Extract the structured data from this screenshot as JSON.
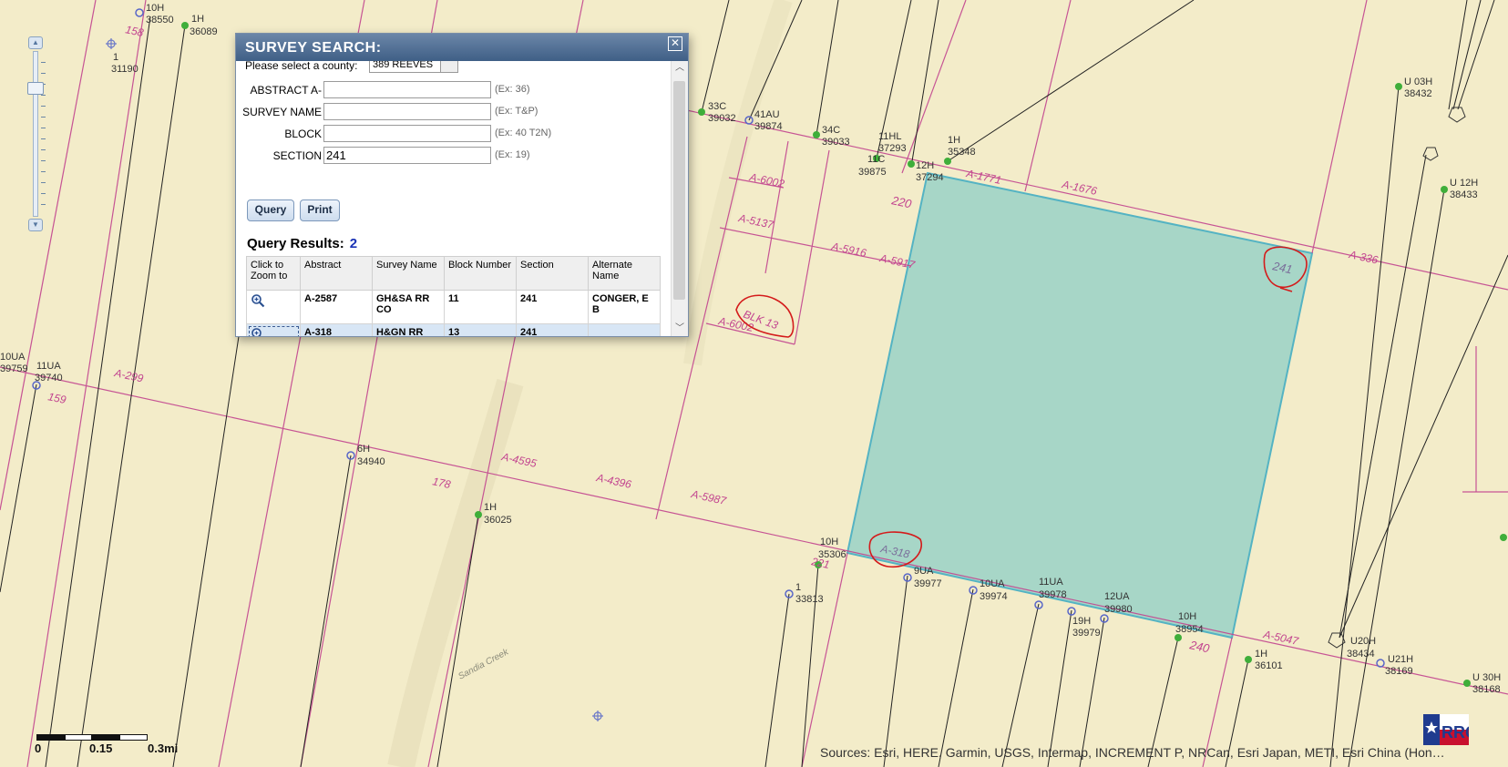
{
  "dialog": {
    "title": "SURVEY SEARCH:",
    "close_glyph": "✕",
    "county_label": "Please select a county:",
    "county_value": "389 REEVES",
    "fields": [
      {
        "label": "ABSTRACT A-",
        "value": "",
        "hint": "(Ex: 36)"
      },
      {
        "label": "SURVEY NAME",
        "value": "",
        "hint": "(Ex: T&P)"
      },
      {
        "label": "BLOCK",
        "value": "",
        "hint": "(Ex: 40 T2N)"
      },
      {
        "label": "SECTION",
        "value": "241",
        "hint": "(Ex: 19)"
      }
    ],
    "query_button": "Query",
    "print_button": "Print",
    "results_label": "Query Results:",
    "results_count": "2",
    "columns": [
      "Click to Zoom to",
      "Abstract",
      "Survey Name",
      "Block Number",
      "Section",
      "Alternate Name"
    ],
    "rows": [
      {
        "abstract": "A-2587",
        "survey": "GH&SA RR CO",
        "block": "11",
        "section": "241",
        "alt": "CONGER, E B"
      },
      {
        "abstract": "A-318",
        "survey": "H&GN RR CO",
        "block": "13",
        "section": "241",
        "alt": ""
      }
    ]
  },
  "map": {
    "wells": [
      {
        "name": "10H",
        "id": "38550"
      },
      {
        "name": "1H",
        "id": "36089"
      },
      {
        "name": "1",
        "id": "31190"
      },
      {
        "name": "33C",
        "id": "39032"
      },
      {
        "name": "41AU",
        "id": "39874"
      },
      {
        "name": "34C",
        "id": "39033"
      },
      {
        "name": "11HL",
        "id": "37293"
      },
      {
        "name": "1H",
        "id": "35348"
      },
      {
        "name": "11C",
        "id": "39875"
      },
      {
        "name": "12H",
        "id": "37294"
      },
      {
        "name": "U 03H",
        "id": "38432"
      },
      {
        "name": "U 12H",
        "id": "38433"
      },
      {
        "name": "10UA",
        "id": "39759"
      },
      {
        "name": "11UA",
        "id": "39740"
      },
      {
        "name": "6H",
        "id": "34940"
      },
      {
        "name": "1H",
        "id": "36025"
      },
      {
        "name": "10H",
        "id": "35306"
      },
      {
        "name": "1",
        "id": "33813"
      },
      {
        "name": "9UA",
        "id": "39977"
      },
      {
        "name": "10UA",
        "id": "39974"
      },
      {
        "name": "11UA",
        "id": "39978"
      },
      {
        "name": "12UA",
        "id": "39980"
      },
      {
        "name": "19H",
        "id": "39979"
      },
      {
        "name": "10H",
        "id": "38954"
      },
      {
        "name": "1H",
        "id": "36101"
      },
      {
        "name": "U20H",
        "id": "38434"
      },
      {
        "name": "U21H",
        "id": "38169"
      },
      {
        "name": "U 30H",
        "id": "38168"
      }
    ],
    "abstract_labels": [
      "A-1771",
      "A-1676",
      "A-6002",
      "A-5137",
      "A-5916",
      "A-5917",
      "A-336",
      "A-6002",
      "A-299",
      "A-4595",
      "A-4396",
      "A-5987",
      "A-5047",
      "A-318"
    ],
    "section_labels": [
      "158",
      "220",
      "241",
      "159",
      "178",
      "221",
      "240",
      "241"
    ],
    "annotation_blk": "BLK 13",
    "creek": "Sandia Creek",
    "accent_color": "#6fbfbc",
    "survey_line_color": "#c2448f",
    "ink_red": "#d41b1b"
  },
  "scale": {
    "labels": [
      "0",
      "0.15",
      "0.3mi"
    ]
  },
  "attribution": "Sources: Esri, HERE, Garmin, USGS, Intermap, INCREMENT P, NRCan, Esri Japan, METI, Esri China (Hon…",
  "logo_text": "RRC"
}
